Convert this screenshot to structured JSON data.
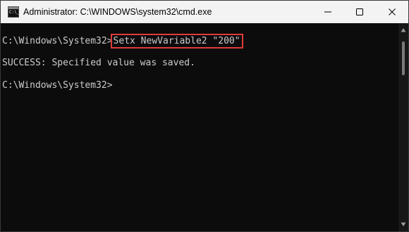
{
  "window": {
    "title": "Administrator: C:\\WINDOWS\\system32\\cmd.exe",
    "icon": "cmd-app-icon",
    "icon_glyph": "C:\\_",
    "controls": [
      "minimize-icon",
      "maximize-icon",
      "close-icon"
    ]
  },
  "console": {
    "lines": [
      {
        "prompt": "C:\\Windows\\System32>",
        "command": "Setx NewVariable2 \"200\""
      },
      {
        "text": "SUCCESS: Specified value was saved."
      },
      {
        "prompt": "C:\\Windows\\System32>"
      }
    ],
    "highlight_color": "#e03a3a",
    "text_color": "#cccccc",
    "background": "#0c0c0c"
  },
  "colors": {
    "titlebar": "#f3f3f3",
    "scrollbar_track": "#171717",
    "scrollbar_thumb": "#7a7a7a"
  }
}
